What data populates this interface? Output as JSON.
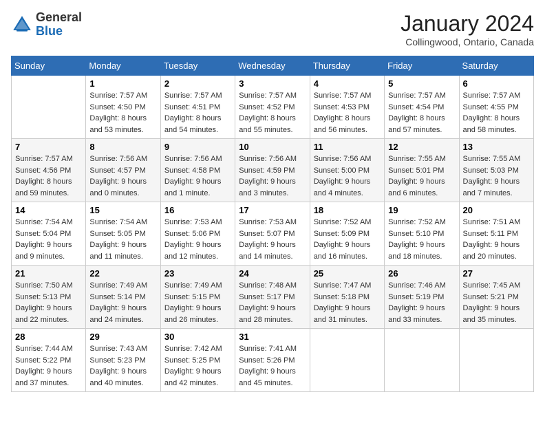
{
  "header": {
    "logo_general": "General",
    "logo_blue": "Blue",
    "month": "January 2024",
    "location": "Collingwood, Ontario, Canada"
  },
  "days_of_week": [
    "Sunday",
    "Monday",
    "Tuesday",
    "Wednesday",
    "Thursday",
    "Friday",
    "Saturday"
  ],
  "weeks": [
    [
      {
        "day": "",
        "info": ""
      },
      {
        "day": "1",
        "info": "Sunrise: 7:57 AM\nSunset: 4:50 PM\nDaylight: 8 hours\nand 53 minutes."
      },
      {
        "day": "2",
        "info": "Sunrise: 7:57 AM\nSunset: 4:51 PM\nDaylight: 8 hours\nand 54 minutes."
      },
      {
        "day": "3",
        "info": "Sunrise: 7:57 AM\nSunset: 4:52 PM\nDaylight: 8 hours\nand 55 minutes."
      },
      {
        "day": "4",
        "info": "Sunrise: 7:57 AM\nSunset: 4:53 PM\nDaylight: 8 hours\nand 56 minutes."
      },
      {
        "day": "5",
        "info": "Sunrise: 7:57 AM\nSunset: 4:54 PM\nDaylight: 8 hours\nand 57 minutes."
      },
      {
        "day": "6",
        "info": "Sunrise: 7:57 AM\nSunset: 4:55 PM\nDaylight: 8 hours\nand 58 minutes."
      }
    ],
    [
      {
        "day": "7",
        "info": "Sunrise: 7:57 AM\nSunset: 4:56 PM\nDaylight: 8 hours\nand 59 minutes."
      },
      {
        "day": "8",
        "info": "Sunrise: 7:56 AM\nSunset: 4:57 PM\nDaylight: 9 hours\nand 0 minutes."
      },
      {
        "day": "9",
        "info": "Sunrise: 7:56 AM\nSunset: 4:58 PM\nDaylight: 9 hours\nand 1 minute."
      },
      {
        "day": "10",
        "info": "Sunrise: 7:56 AM\nSunset: 4:59 PM\nDaylight: 9 hours\nand 3 minutes."
      },
      {
        "day": "11",
        "info": "Sunrise: 7:56 AM\nSunset: 5:00 PM\nDaylight: 9 hours\nand 4 minutes."
      },
      {
        "day": "12",
        "info": "Sunrise: 7:55 AM\nSunset: 5:01 PM\nDaylight: 9 hours\nand 6 minutes."
      },
      {
        "day": "13",
        "info": "Sunrise: 7:55 AM\nSunset: 5:03 PM\nDaylight: 9 hours\nand 7 minutes."
      }
    ],
    [
      {
        "day": "14",
        "info": "Sunrise: 7:54 AM\nSunset: 5:04 PM\nDaylight: 9 hours\nand 9 minutes."
      },
      {
        "day": "15",
        "info": "Sunrise: 7:54 AM\nSunset: 5:05 PM\nDaylight: 9 hours\nand 11 minutes."
      },
      {
        "day": "16",
        "info": "Sunrise: 7:53 AM\nSunset: 5:06 PM\nDaylight: 9 hours\nand 12 minutes."
      },
      {
        "day": "17",
        "info": "Sunrise: 7:53 AM\nSunset: 5:07 PM\nDaylight: 9 hours\nand 14 minutes."
      },
      {
        "day": "18",
        "info": "Sunrise: 7:52 AM\nSunset: 5:09 PM\nDaylight: 9 hours\nand 16 minutes."
      },
      {
        "day": "19",
        "info": "Sunrise: 7:52 AM\nSunset: 5:10 PM\nDaylight: 9 hours\nand 18 minutes."
      },
      {
        "day": "20",
        "info": "Sunrise: 7:51 AM\nSunset: 5:11 PM\nDaylight: 9 hours\nand 20 minutes."
      }
    ],
    [
      {
        "day": "21",
        "info": "Sunrise: 7:50 AM\nSunset: 5:13 PM\nDaylight: 9 hours\nand 22 minutes."
      },
      {
        "day": "22",
        "info": "Sunrise: 7:49 AM\nSunset: 5:14 PM\nDaylight: 9 hours\nand 24 minutes."
      },
      {
        "day": "23",
        "info": "Sunrise: 7:49 AM\nSunset: 5:15 PM\nDaylight: 9 hours\nand 26 minutes."
      },
      {
        "day": "24",
        "info": "Sunrise: 7:48 AM\nSunset: 5:17 PM\nDaylight: 9 hours\nand 28 minutes."
      },
      {
        "day": "25",
        "info": "Sunrise: 7:47 AM\nSunset: 5:18 PM\nDaylight: 9 hours\nand 31 minutes."
      },
      {
        "day": "26",
        "info": "Sunrise: 7:46 AM\nSunset: 5:19 PM\nDaylight: 9 hours\nand 33 minutes."
      },
      {
        "day": "27",
        "info": "Sunrise: 7:45 AM\nSunset: 5:21 PM\nDaylight: 9 hours\nand 35 minutes."
      }
    ],
    [
      {
        "day": "28",
        "info": "Sunrise: 7:44 AM\nSunset: 5:22 PM\nDaylight: 9 hours\nand 37 minutes."
      },
      {
        "day": "29",
        "info": "Sunrise: 7:43 AM\nSunset: 5:23 PM\nDaylight: 9 hours\nand 40 minutes."
      },
      {
        "day": "30",
        "info": "Sunrise: 7:42 AM\nSunset: 5:25 PM\nDaylight: 9 hours\nand 42 minutes."
      },
      {
        "day": "31",
        "info": "Sunrise: 7:41 AM\nSunset: 5:26 PM\nDaylight: 9 hours\nand 45 minutes."
      },
      {
        "day": "",
        "info": ""
      },
      {
        "day": "",
        "info": ""
      },
      {
        "day": "",
        "info": ""
      }
    ]
  ]
}
